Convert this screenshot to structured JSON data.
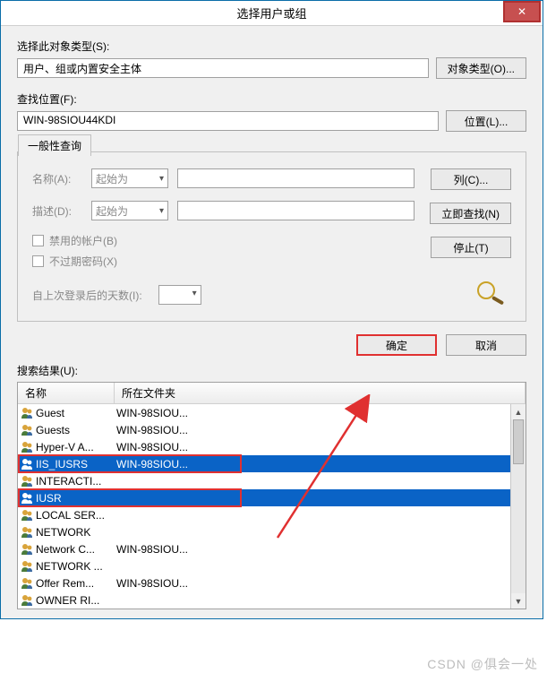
{
  "title": "选择用户或组",
  "object_type_label": "选择此对象类型(S):",
  "object_type_value": "用户、组或内置安全主体",
  "object_type_button": "对象类型(O)...",
  "location_label": "查找位置(F):",
  "location_value": "WIN-98SIOU44KDI",
  "location_button": "位置(L)...",
  "tab_label": "一般性查询",
  "query": {
    "name_label": "名称(A):",
    "name_combo": "起始为",
    "desc_label": "描述(D):",
    "desc_combo": "起始为",
    "disabled_label": "禁用的帐户(B)",
    "noexpire_label": "不过期密码(X)",
    "days_label": "自上次登录后的天数(I):"
  },
  "buttons": {
    "columns": "列(C)...",
    "findnow": "立即查找(N)",
    "stop": "停止(T)",
    "ok": "确定",
    "cancel": "取消"
  },
  "results_label": "搜索结果(U):",
  "columns": {
    "name": "名称",
    "folder": "所在文件夹"
  },
  "rows": [
    {
      "type": "user",
      "name": "Guest",
      "loc": "WIN-98SIOU..."
    },
    {
      "type": "group",
      "name": "Guests",
      "loc": "WIN-98SIOU..."
    },
    {
      "type": "group",
      "name": "Hyper-V A...",
      "loc": "WIN-98SIOU..."
    },
    {
      "type": "group",
      "name": "IIS_IUSRS",
      "loc": "WIN-98SIOU...",
      "selected": true,
      "highlight": true
    },
    {
      "type": "group",
      "name": "INTERACTI...",
      "loc": ""
    },
    {
      "type": "user",
      "name": "IUSR",
      "loc": "",
      "selected": true,
      "highlight": true
    },
    {
      "type": "group",
      "name": "LOCAL SER...",
      "loc": ""
    },
    {
      "type": "group",
      "name": "NETWORK",
      "loc": ""
    },
    {
      "type": "group",
      "name": "Network C...",
      "loc": "WIN-98SIOU..."
    },
    {
      "type": "group",
      "name": "NETWORK ...",
      "loc": ""
    },
    {
      "type": "group",
      "name": "Offer Rem...",
      "loc": "WIN-98SIOU..."
    },
    {
      "type": "user",
      "name": "OWNER RI...",
      "loc": ""
    }
  ],
  "watermark": "CSDN @俱会一处"
}
